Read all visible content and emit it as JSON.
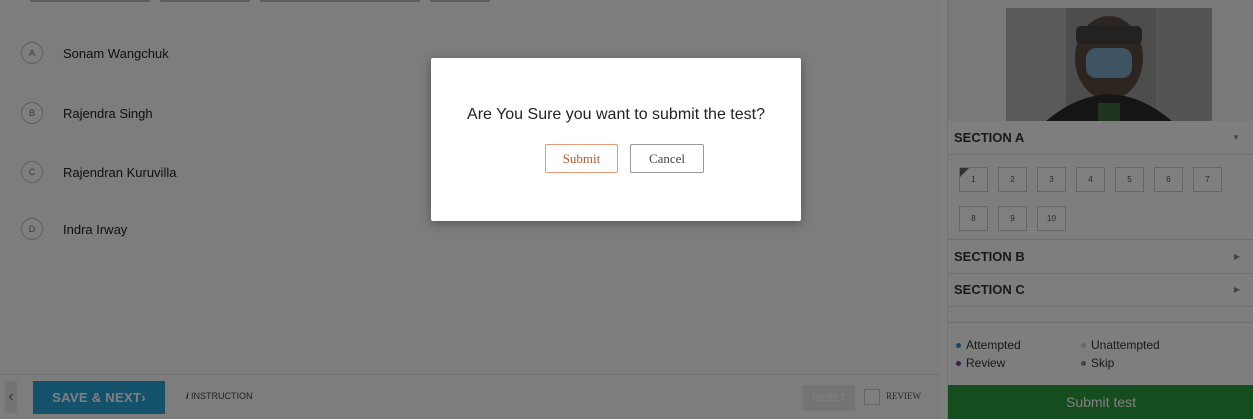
{
  "options": [
    {
      "letter": "A",
      "text": "Sonam Wangchuk"
    },
    {
      "letter": "B",
      "text": "Rajendra Singh"
    },
    {
      "letter": "C",
      "text": "Rajendran Kuruvilla"
    },
    {
      "letter": "D",
      "text": "Indra Irway"
    }
  ],
  "bottom_bar": {
    "prev_icon": "chevron-left-icon",
    "save_next_label": "SAVE & NEXT",
    "save_next_arrow": "›",
    "instruction_label": "INSTRUCTION",
    "instruction_icon": "i",
    "reset_label": "RESET",
    "review_label": "REVIEW"
  },
  "sidebar": {
    "webcam_label": "webcam-feed",
    "sections": [
      {
        "label": "SECTION A",
        "expanded": true
      },
      {
        "label": "SECTION B",
        "expanded": false
      },
      {
        "label": "SECTION C",
        "expanded": false
      }
    ],
    "questions": [
      "1",
      "2",
      "3",
      "4",
      "5",
      "6",
      "7",
      "8",
      "9",
      "10"
    ],
    "current_question": "1",
    "legend": {
      "attempted": "Attempted",
      "unattempted": "Unattempted",
      "review": "Review",
      "skip": "Skip"
    },
    "legend_colors": {
      "attempted": "#2d8fc7",
      "unattempted": "#d0d0d0",
      "review": "#7b3fa0",
      "skip": "#888888"
    },
    "submit_label": "Submit test"
  },
  "modal": {
    "message": "Are You Sure you want to submit the test?",
    "submit_label": "Submit",
    "cancel_label": "Cancel"
  },
  "colors": {
    "save_next": "#29a3d6",
    "submit_test": "#2c9a3c",
    "modal_submit_border": "#e69a77"
  }
}
